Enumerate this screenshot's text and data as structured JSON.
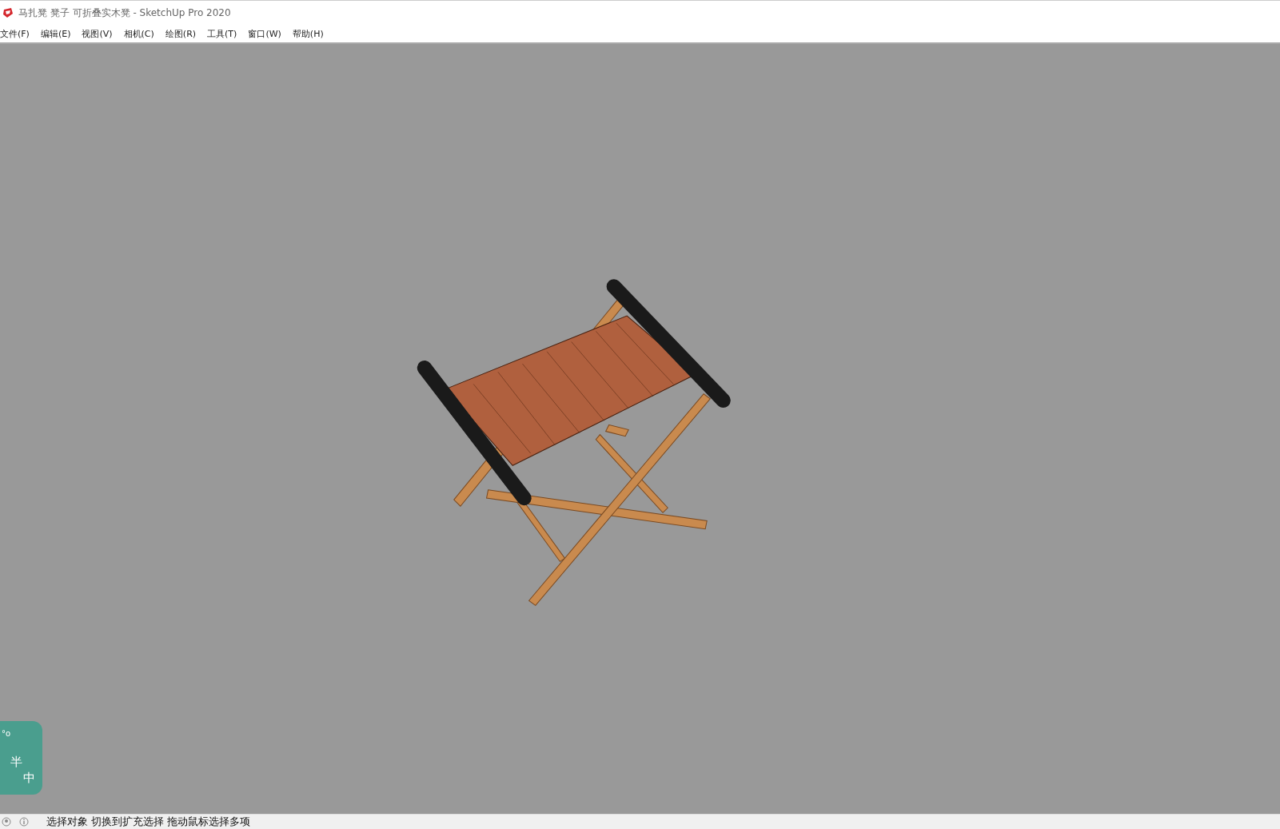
{
  "window": {
    "title": "马扎凳 凳子 可折叠实木凳 - SketchUp Pro 2020"
  },
  "menu": [
    "文件(F)",
    "编辑(E)",
    "视图(V)",
    "相机(C)",
    "绘图(R)",
    "工具(T)",
    "窗口(W)",
    "帮助(H)"
  ],
  "ime": {
    "dot": "°o",
    "width_mode": "半",
    "language": "中"
  },
  "status_bar": {
    "message": "选择对象  切换到扩充选择  拖动鼠标选择多项"
  }
}
